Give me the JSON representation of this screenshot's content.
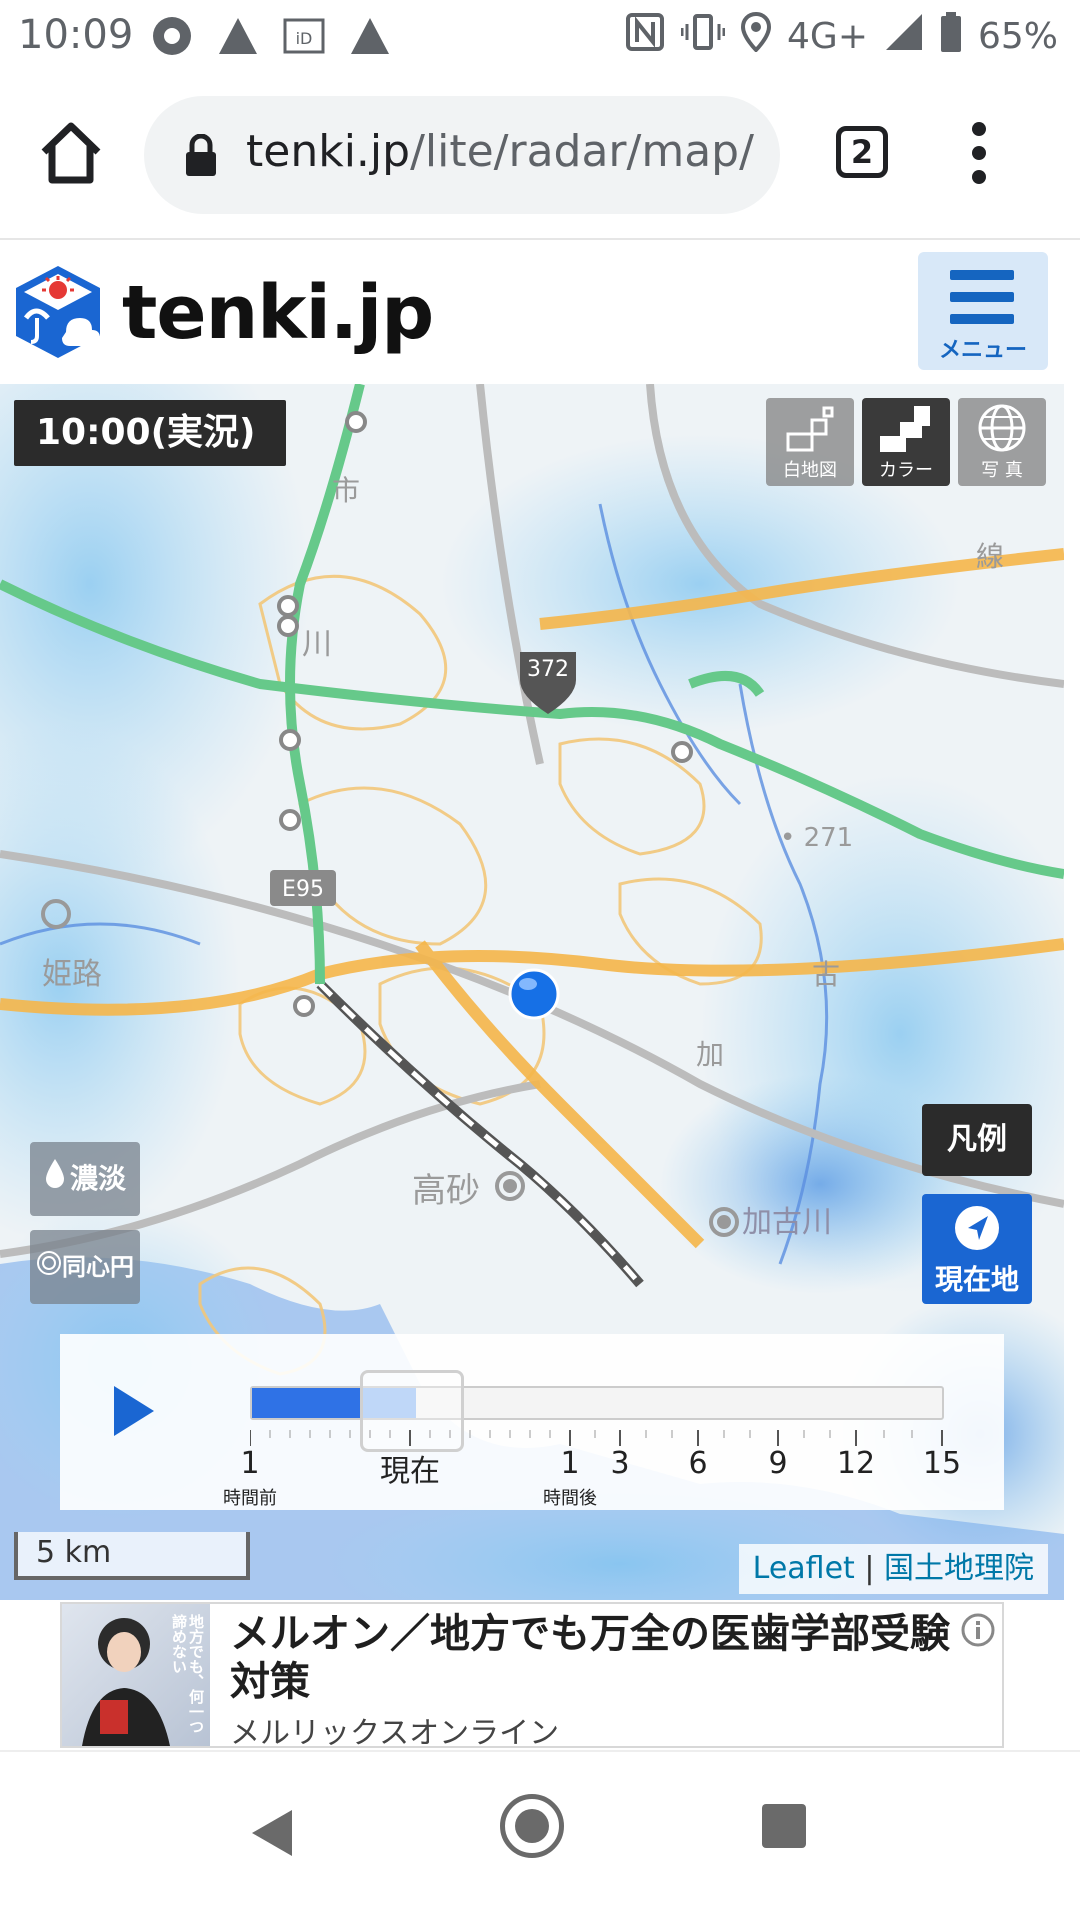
{
  "status_bar": {
    "time": "10:09",
    "network": "4G+",
    "battery": "65%",
    "icons": [
      "chat-icon",
      "alert-icon",
      "id-icon",
      "alert-icon",
      "nfc-icon",
      "vibrate-icon",
      "location-icon",
      "signal-icon",
      "battery-icon"
    ]
  },
  "browser": {
    "url_domain": "tenki.jp",
    "url_path": "/lite/radar/map/",
    "tab_count": "2"
  },
  "header": {
    "logo_text": "tenki.jp",
    "menu_label": "メニュー",
    "accent_color": "#1565c0"
  },
  "map": {
    "time_badge": "10:00(実況)",
    "map_types": {
      "white": "白地図",
      "color": "カラー",
      "photo": "写 真"
    },
    "labels": {
      "route_372": "372",
      "route_e95": "E95",
      "takasago": "高砂",
      "kakogawa": "加古川",
      "himeji": "姫路",
      "kawa": "川",
      "ichi": "市",
      "ka": "加",
      "ko": "古",
      "sen": "線",
      "elev": "• 271"
    },
    "side_buttons": {
      "shade": "濃淡",
      "circles": "同心円"
    },
    "legend_label": "凡例",
    "locate_label": "現在地",
    "scale": "5 km",
    "attribution_leaflet": "Leaflet",
    "attribution_sep": " | ",
    "attribution_gsi": "国土地理院"
  },
  "timeline": {
    "ticks": [
      {
        "label": "1",
        "sub": "時間前"
      },
      {
        "label": "現在",
        "sub": ""
      },
      {
        "label": "1",
        "sub": "時間後"
      },
      {
        "label": "3",
        "sub": ""
      },
      {
        "label": "6",
        "sub": ""
      },
      {
        "label": "9",
        "sub": ""
      },
      {
        "label": "12",
        "sub": ""
      },
      {
        "label": "15",
        "sub": ""
      }
    ]
  },
  "ad": {
    "title": "メルオン／地方でも万全の医歯学部受験対策",
    "sponsor": "メルリックスオンライン",
    "image_text": "地方でも、何一つ諦めない"
  }
}
